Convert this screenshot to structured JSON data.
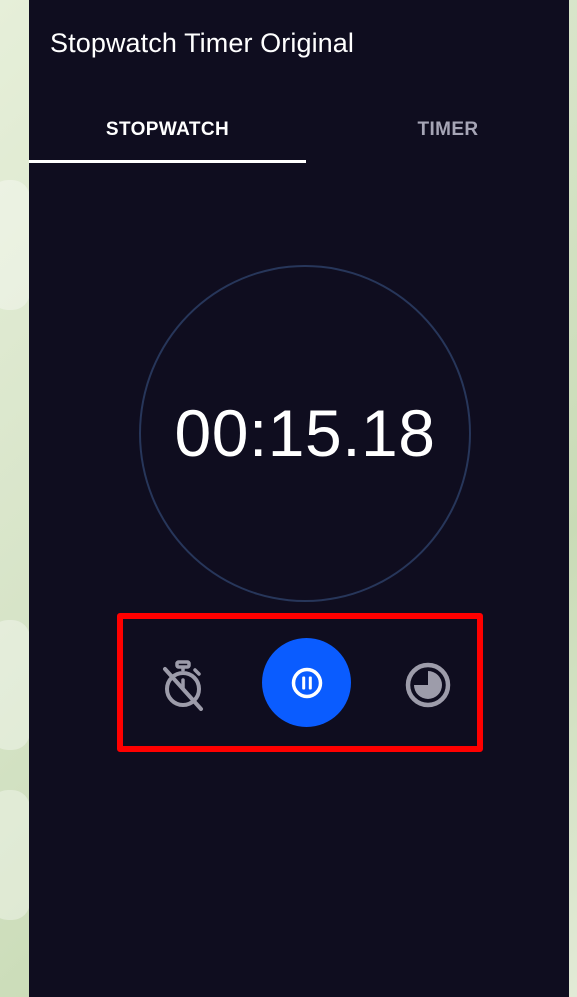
{
  "app": {
    "title": "Stopwatch Timer Original"
  },
  "tabs": [
    {
      "label": "STOPWATCH",
      "selected": true
    },
    {
      "label": "TIMER",
      "selected": false
    }
  ],
  "stopwatch": {
    "elapsed": "00:15.18",
    "state": "running"
  },
  "controls": {
    "reset_icon": "timer-off-icon",
    "pause_icon": "pause-icon",
    "lap_icon": "pie-chart-icon"
  },
  "colors": {
    "background": "#0f0d1f",
    "accent": "#0a5cff",
    "dial_ring": "#27365a",
    "inactive_tab": "#a6a5b6",
    "highlight": "#ff0000"
  }
}
